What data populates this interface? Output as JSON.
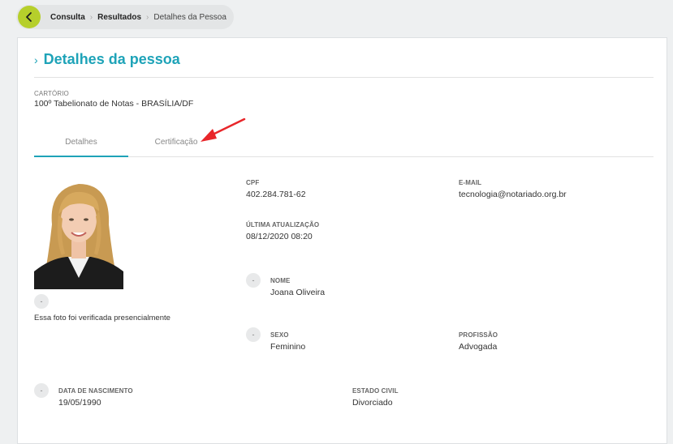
{
  "breadcrumb": {
    "items": [
      "Consulta",
      "Resultados",
      "Detalhes da Pessoa"
    ]
  },
  "page": {
    "title": "Detalhes da pessoa"
  },
  "cartorio": {
    "label": "CARTÓRIO",
    "value": "100º Tabelionato de Notas - BRASÍLIA/DF"
  },
  "tabs": [
    {
      "label": "Detalhes",
      "active": true
    },
    {
      "label": "Certificação",
      "active": false
    }
  ],
  "photo": {
    "status_dash": "-",
    "caption": "Essa foto foi verificada presencialmente"
  },
  "fields": {
    "cpf": {
      "label": "CPF",
      "value": "402.284.781-62"
    },
    "email": {
      "label": "E-MAIL",
      "value": "tecnologia@notariado.org.br"
    },
    "ultima_atualizacao": {
      "label": "ÚLTIMA ATUALIZAÇÃO",
      "value": "08/12/2020 08:20"
    },
    "nome": {
      "label": "NOME",
      "value": "Joana Oliveira",
      "dash": "-"
    },
    "sexo": {
      "label": "SEXO",
      "value": "Feminino",
      "dash": "-"
    },
    "profissao": {
      "label": "PROFISSÃO",
      "value": "Advogada"
    },
    "data_nascimento": {
      "label": "DATA DE NASCIMENTO",
      "value": "19/05/1990",
      "dash": "-"
    },
    "estado_civil": {
      "label": "ESTADO CIVIL",
      "value": "Divorciado"
    }
  },
  "colors": {
    "accent": "#1ea3b8",
    "back_button": "#b6cf2b",
    "annotation_arrow": "#e8262a"
  },
  "icons": {
    "back": "chevron-left-icon",
    "title": "chevron-right-icon",
    "crumb_separator": "chevron-right-icon"
  }
}
